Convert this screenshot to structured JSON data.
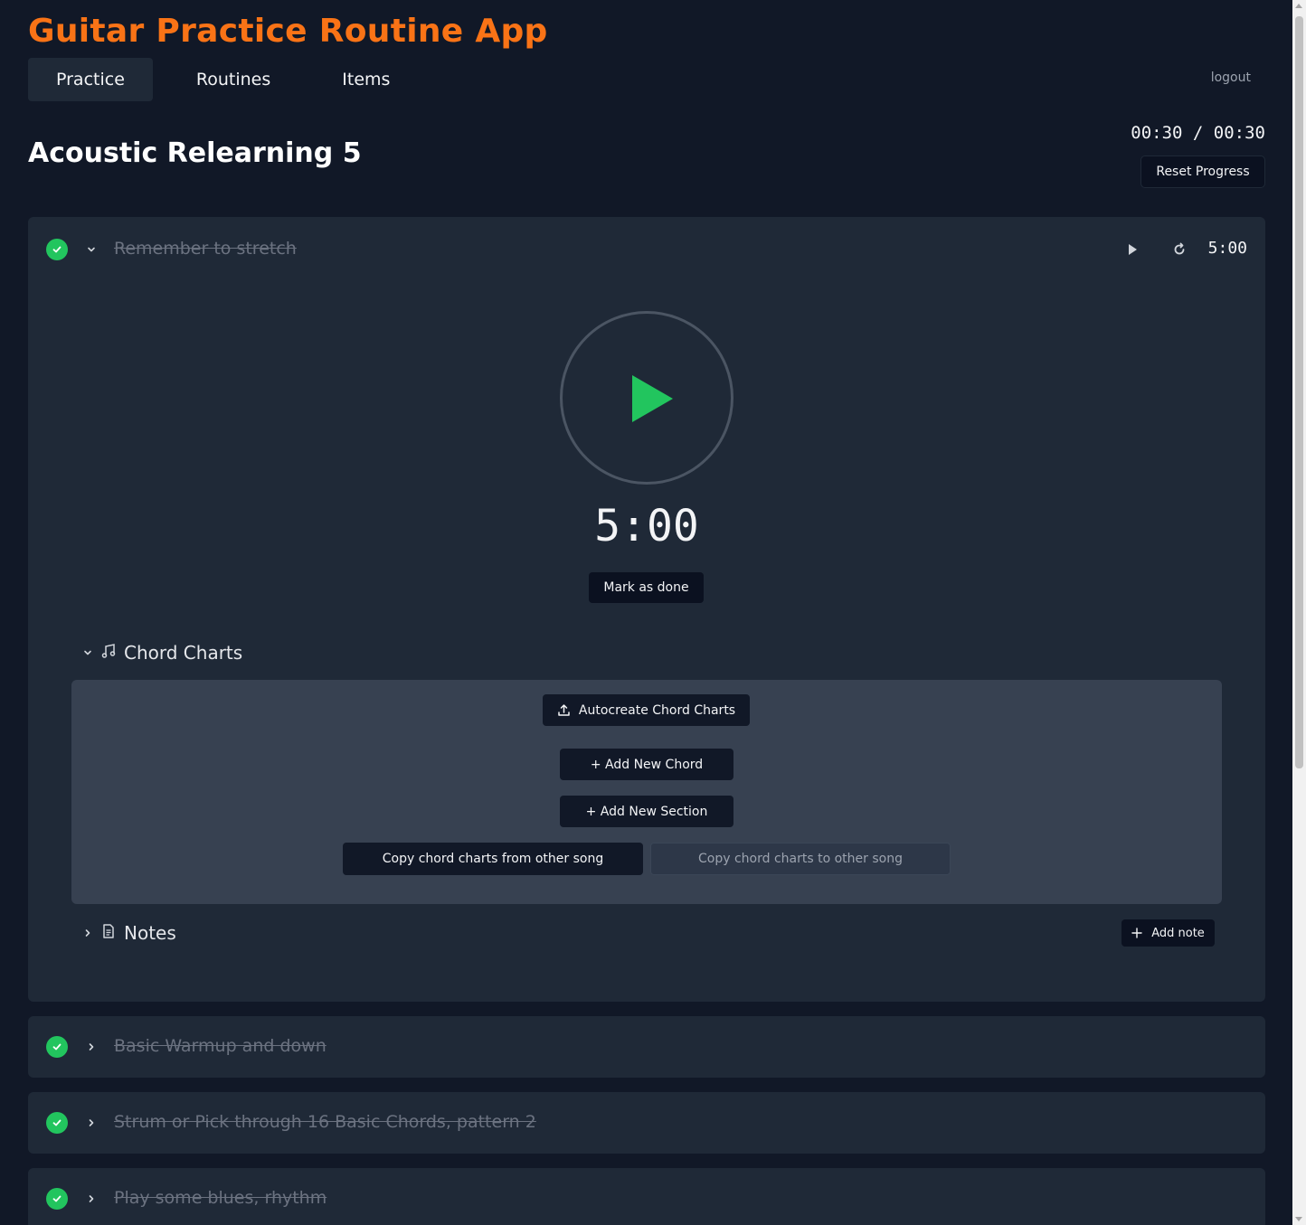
{
  "app": {
    "title": "Guitar Practice Routine App"
  },
  "nav": {
    "tabs": [
      {
        "label": "Practice",
        "active": true
      },
      {
        "label": "Routines",
        "active": false
      },
      {
        "label": "Items",
        "active": false
      }
    ],
    "logout_label": "logout"
  },
  "routine": {
    "title": "Acoustic Relearning 5",
    "total_time": "00:30 / 00:30",
    "reset_label": "Reset Progress"
  },
  "current_item": {
    "title": "Remember to stretch",
    "done": true,
    "header_time": "5:00",
    "big_time": "5:00",
    "mark_done_label": "Mark as done",
    "chord_charts": {
      "label": "Chord Charts",
      "autocreate_label": "Autocreate Chord Charts",
      "add_chord_label": "+ Add New Chord",
      "add_section_label": "+ Add New Section",
      "copy_from_label": "Copy chord charts from other song",
      "copy_to_label": "Copy chord charts to other song"
    },
    "notes": {
      "label": "Notes",
      "add_note_label": "Add note"
    }
  },
  "other_items": [
    {
      "title": "Basic Warmup and down",
      "done": true
    },
    {
      "title": "Strum or Pick through 16 Basic Chords, pattern 2",
      "done": true
    },
    {
      "title": "Play some blues, rhythm",
      "done": true
    }
  ],
  "colors": {
    "accent": "#f97316",
    "success": "#22c55e",
    "background": "#111827",
    "card": "#1f2937",
    "panel": "#374151"
  }
}
